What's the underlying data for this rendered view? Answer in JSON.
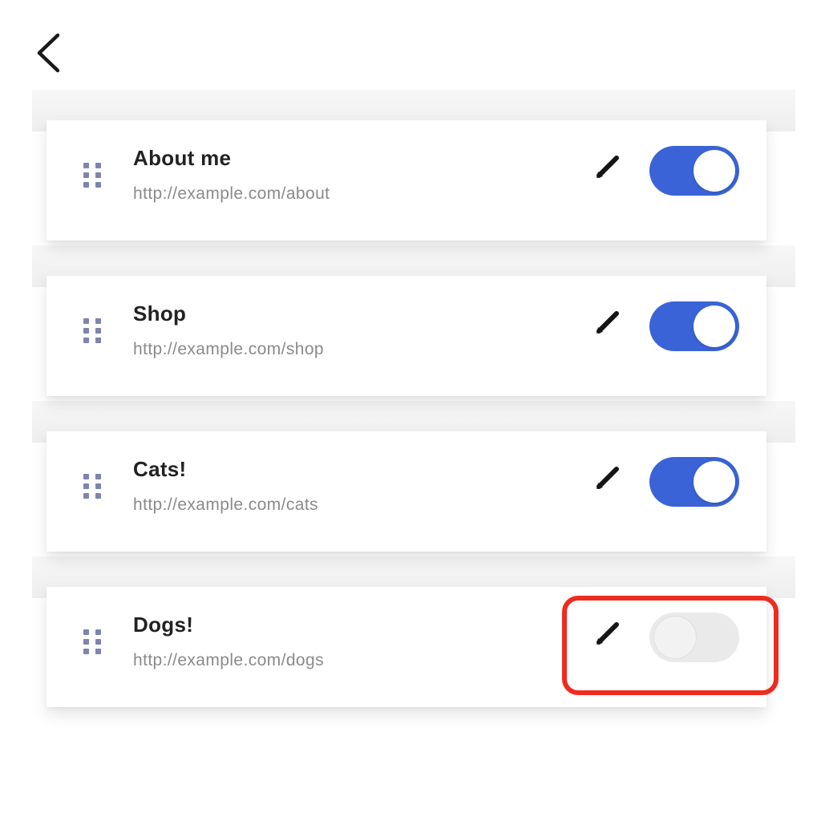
{
  "header": {
    "back_icon": "chevron-left-icon"
  },
  "links": [
    {
      "title": "About me",
      "url": "http://example.com/about",
      "enabled": true
    },
    {
      "title": "Shop",
      "url": "http://example.com/shop",
      "enabled": true
    },
    {
      "title": "Cats!",
      "url": "http://example.com/cats",
      "enabled": true
    },
    {
      "title": "Dogs!",
      "url": "http://example.com/dogs",
      "enabled": false
    }
  ],
  "icons": {
    "drag": "drag-handle-icon",
    "edit": "pencil-icon"
  },
  "colors": {
    "toggle_on": "#3a63d7",
    "toggle_off": "#eaeaea",
    "highlight": "#ef2b1f"
  },
  "annotation": {
    "highlighted_item": "Dogs! toggle"
  }
}
